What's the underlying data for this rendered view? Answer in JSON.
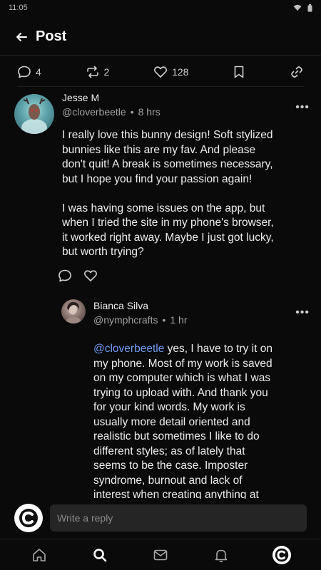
{
  "status_bar": {
    "time": "11:05"
  },
  "header": {
    "title": "Post"
  },
  "actions": {
    "comments": "4",
    "reposts": "2",
    "likes": "128"
  },
  "comment": {
    "author": "Jesse M",
    "handle": "@cloverbeetle",
    "time": "8 hrs",
    "more": "•••",
    "text": "I really love this bunny design! Soft stylized bunnies like this are my fav. And please don't quit! A break is sometimes necessary, but I hope you find your passion again!\n\nI was having some issues on the app, but when I tried the site in my phone's browser, it worked right away. Maybe I just got lucky, but worth trying?"
  },
  "reply": {
    "author": "Bianca Silva",
    "handle": "@nymphcrafts",
    "time": "1 hr",
    "more": "•••",
    "mention": "@cloverbeetle",
    "text": " yes, I have to try it on my phone. Most of my work is saved on my computer which is what I was trying to upload with. And thank you for your kind words. My work is usually more detail oriented and realistic but sometimes I like to do different styles; as of lately that seems to be the case. Imposter syndrome, burnout and lack of interest when creating anything at the moment"
  },
  "reply_bar": {
    "placeholder": "Write a reply"
  },
  "colors": {
    "background": "#0a0a0a",
    "mention": "#6f9cf0",
    "input": "#252525"
  }
}
